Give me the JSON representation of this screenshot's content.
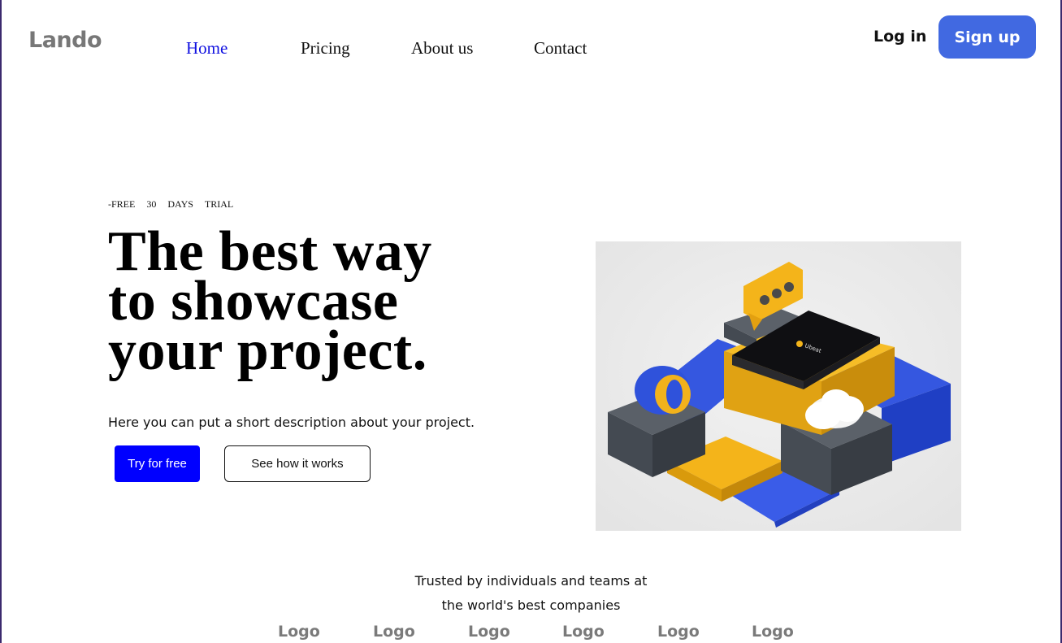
{
  "header": {
    "brand": "Lando",
    "nav": [
      {
        "label": "Home",
        "active": true
      },
      {
        "label": "Pricing",
        "active": false
      },
      {
        "label": "About us",
        "active": false
      },
      {
        "label": "Contact",
        "active": false
      }
    ],
    "login_label": "Log in",
    "signup_label": "Sign up"
  },
  "hero": {
    "tagline": [
      "-FREE",
      "30",
      "DAYS",
      "TRIAL"
    ],
    "headline": [
      "The best way",
      "to showcase",
      "your project."
    ],
    "description": "Here you can put a short description about your project.",
    "primary_cta": "Try for free",
    "secondary_cta": "See how it works",
    "phone_screen_text": "Ubeat"
  },
  "trusted": {
    "line1": "Trusted by individuals and teams at",
    "line2": "the world's best companies",
    "logos": [
      "Logo",
      "Logo",
      "Logo",
      "Logo",
      "Logo",
      "Logo"
    ]
  },
  "colors": {
    "accent": "#4169e1",
    "primary_button": "#0000ff",
    "active_nav": "#1010e0",
    "brand_gray": "#777777"
  }
}
